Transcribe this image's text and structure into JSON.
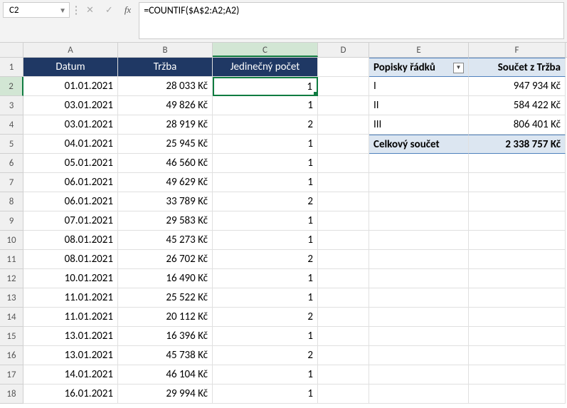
{
  "nameBox": "C2",
  "formula": "=COUNTIF($A$2:A2;A2)",
  "columns": [
    "A",
    "B",
    "C",
    "D",
    "E",
    "F"
  ],
  "rowNums": [
    1,
    2,
    3,
    4,
    5,
    6,
    7,
    8,
    9,
    10,
    11,
    12,
    13,
    14,
    15,
    16,
    17,
    18
  ],
  "headers": {
    "A": "Datum",
    "B": "Tržba",
    "C": "Jedinečný počet"
  },
  "rows": [
    {
      "A": "01.01.2021",
      "B": "28 033 Kč",
      "C": "1"
    },
    {
      "A": "03.01.2021",
      "B": "49 826 Kč",
      "C": "1"
    },
    {
      "A": "03.01.2021",
      "B": "28 919 Kč",
      "C": "2"
    },
    {
      "A": "04.01.2021",
      "B": "25 945 Kč",
      "C": "1"
    },
    {
      "A": "05.01.2021",
      "B": "46 560 Kč",
      "C": "1"
    },
    {
      "A": "06.01.2021",
      "B": "49 629 Kč",
      "C": "1"
    },
    {
      "A": "06.01.2021",
      "B": "33 789 Kč",
      "C": "2"
    },
    {
      "A": "07.01.2021",
      "B": "29 583 Kč",
      "C": "1"
    },
    {
      "A": "08.01.2021",
      "B": "45 273 Kč",
      "C": "1"
    },
    {
      "A": "08.01.2021",
      "B": "26 702 Kč",
      "C": "2"
    },
    {
      "A": "10.01.2021",
      "B": "16 490 Kč",
      "C": "1"
    },
    {
      "A": "11.01.2021",
      "B": "25 522 Kč",
      "C": "1"
    },
    {
      "A": "11.01.2021",
      "B": "20 112 Kč",
      "C": "2"
    },
    {
      "A": "13.01.2021",
      "B": "16 396 Kč",
      "C": "1"
    },
    {
      "A": "13.01.2021",
      "B": "45 738 Kč",
      "C": "2"
    },
    {
      "A": "14.01.2021",
      "B": "46 104 Kč",
      "C": "1"
    },
    {
      "A": "16.01.2021",
      "B": "29 994 Kč",
      "C": "1"
    }
  ],
  "pivot": {
    "header": {
      "label": "Popisky řádků",
      "value": "Součet z Tržba"
    },
    "rows": [
      {
        "label": "I",
        "value": "947 934 Kč"
      },
      {
        "label": "II",
        "value": "584 422 Kč"
      },
      {
        "label": "III",
        "value": "806 401 Kč"
      }
    ],
    "total": {
      "label": "Celkový součet",
      "value": "2 338 757 Kč"
    }
  },
  "fxLabel": "fx",
  "chevron": "▼"
}
